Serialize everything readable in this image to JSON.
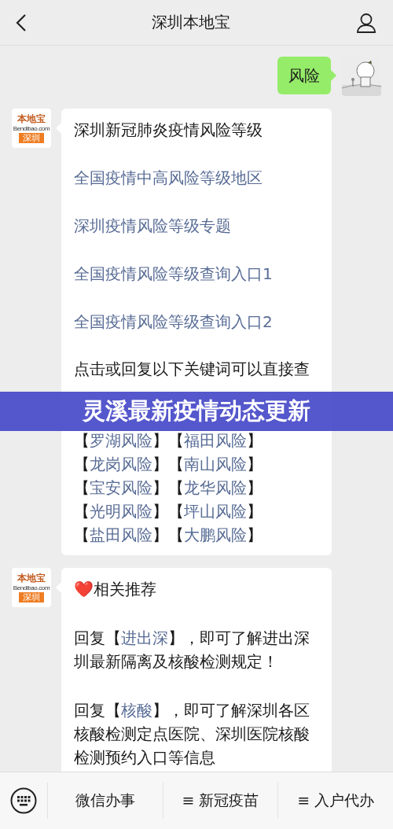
{
  "header": {
    "title": "深圳本地宝"
  },
  "messages": [
    {
      "kind": "user",
      "text": "风险"
    },
    {
      "kind": "card",
      "logo": {
        "brand": "本地宝",
        "domain": "Bendibao.com",
        "city": "深圳"
      },
      "title": "深圳新冠肺炎疫情风险等级",
      "links": [
        "全国疫情中高风险等级地区",
        "深圳疫情风险等级专题",
        "全国疫情风险等级查询入口1",
        "全国疫情风险等级查询入口2"
      ],
      "intro": "点击或回复以下关键词可以直接查",
      "region_rows": [
        [
          {
            "open": "【",
            "link": "罗湖风险",
            "close": "】"
          },
          {
            "open": "【",
            "link": "福田风险",
            "close": "】"
          }
        ],
        [
          {
            "open": "【",
            "link": "龙岗风险",
            "close": "】"
          },
          {
            "open": "【",
            "link": "南山风险",
            "close": "】"
          }
        ],
        [
          {
            "open": "【",
            "link": "宝安风险",
            "close": "】"
          },
          {
            "open": "【",
            "link": "龙华风险",
            "close": "】"
          }
        ],
        [
          {
            "open": "【",
            "link": "光明风险",
            "close": "】"
          },
          {
            "open": "【",
            "link": "坪山风险",
            "close": "】"
          }
        ],
        [
          {
            "open": "【",
            "link": "盐田风险",
            "close": "】"
          },
          {
            "open": "【",
            "link": "大鹏风险",
            "close": "】"
          }
        ]
      ]
    },
    {
      "kind": "recommend",
      "logo": {
        "brand": "本地宝",
        "domain": "Bendibao.com",
        "city": "深圳"
      },
      "heart": "❤️",
      "title": "相关推荐",
      "paragraphs": [
        {
          "before": "回复【",
          "link": "进出深",
          "after": "】，即可了解进出深圳最新隔离及核酸检测规定！"
        },
        {
          "before": "回复【",
          "link": "核酸",
          "after": "】，即可了解深圳各区核酸检测定点医院、深圳医院核酸检测预约入口等信息"
        }
      ]
    }
  ],
  "banner": "灵溪最新疫情动态更新",
  "menu": [
    {
      "label": "微信办事"
    },
    {
      "glyph": "≡",
      "label": "新冠疫苗"
    },
    {
      "glyph": "≡",
      "label": "入户代办"
    }
  ]
}
